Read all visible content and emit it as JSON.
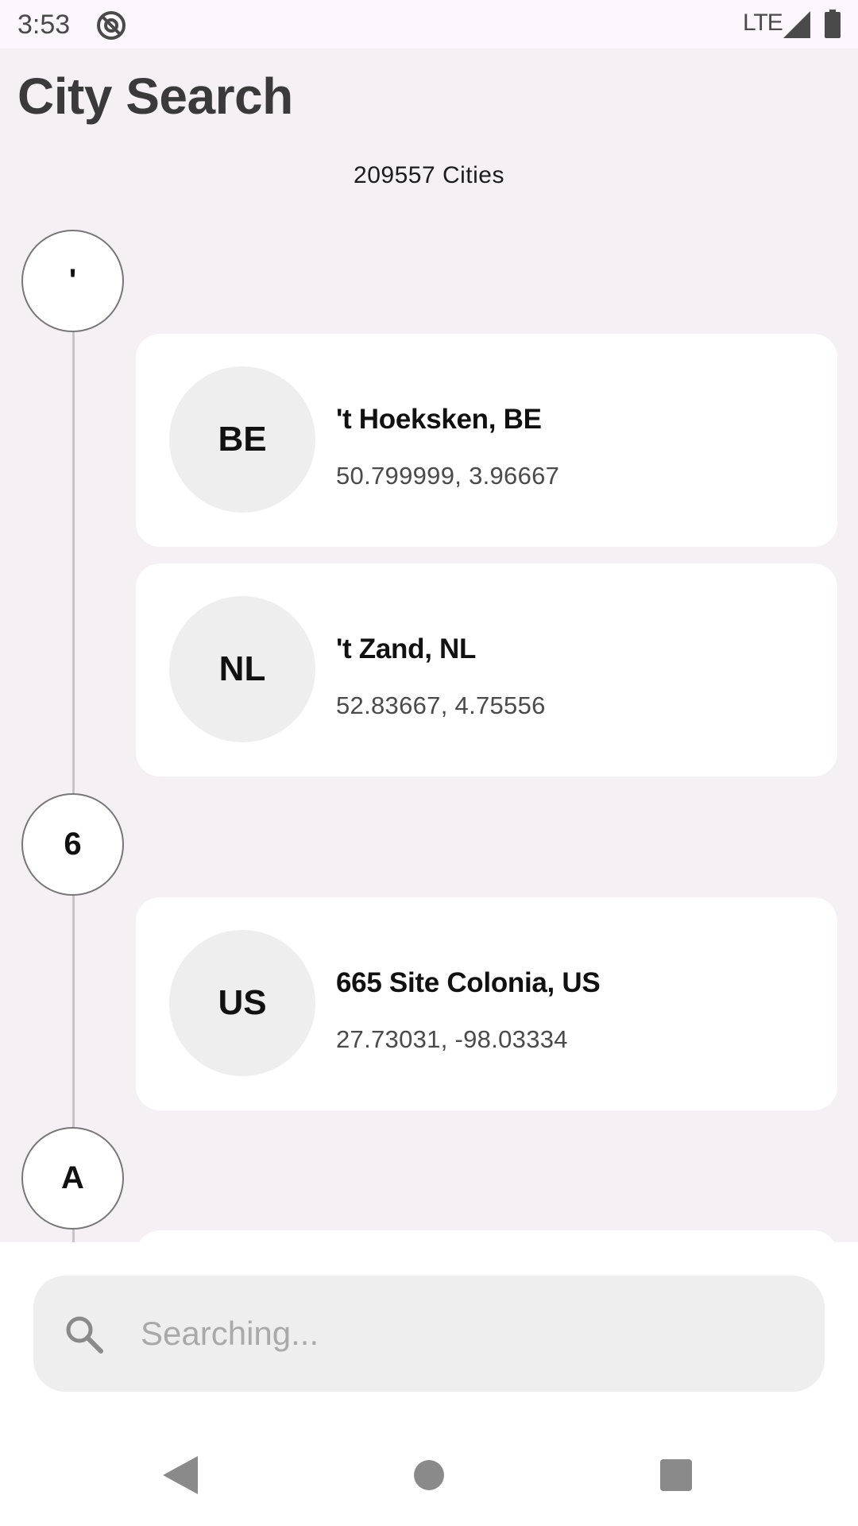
{
  "status_bar": {
    "time": "3:53",
    "network": "LTE",
    "icons": [
      "app-notification-icon",
      "signal-icon",
      "battery-icon"
    ]
  },
  "header": {
    "title": "City Search",
    "count_label": "209557 Cities"
  },
  "sections": [
    {
      "letter": "'",
      "cities": [
        {
          "country": "BE",
          "name": "'t Hoeksken, BE",
          "coords": "50.799999, 3.96667"
        },
        {
          "country": "NL",
          "name": "'t Zand, NL",
          "coords": "52.83667, 4.75556"
        }
      ]
    },
    {
      "letter": "6",
      "cities": [
        {
          "country": "US",
          "name": "665 Site Colonia, US",
          "coords": "27.73031, -98.03334"
        }
      ]
    },
    {
      "letter": "A",
      "cities": []
    }
  ],
  "search": {
    "placeholder": "Searching...",
    "value": "",
    "icon": "search-icon"
  },
  "nav_bar": {
    "icons": [
      "back-icon",
      "home-icon",
      "recents-icon"
    ]
  },
  "colors": {
    "background": "#f4f0f4",
    "card": "#ffffff",
    "badge": "#eeeeee",
    "timeline": "#c5c5c5",
    "status_bar": "#fcf7fc"
  }
}
